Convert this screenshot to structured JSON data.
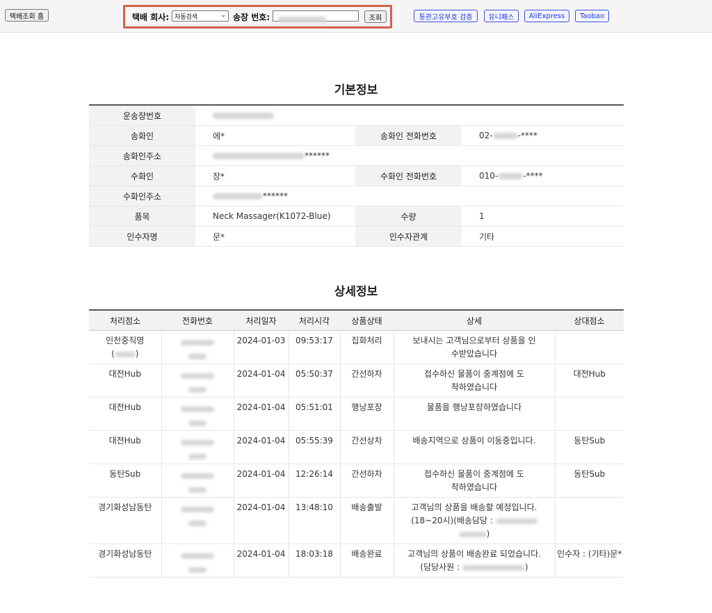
{
  "toolbar": {
    "home_button": "택배조회 홈",
    "carrier_label": "택배 회사:",
    "carrier_value": "자동검색",
    "tracking_label": "송장 번호:",
    "search_button": "조회",
    "links": [
      "통관고유부호 검증",
      "유니패스",
      "AliExpress",
      "Taobao"
    ]
  },
  "basic_info": {
    "title": "기본정보",
    "waybill_label": "운송장번호",
    "sender_label": "송화인",
    "sender_value": "에*",
    "sender_phone_label": "송화인 전화번호",
    "sender_phone_prefix": "02-",
    "sender_phone_suffix": "-****",
    "sender_address_label": "송화인주소",
    "sender_address_suffix": "******",
    "receiver_label": "수화인",
    "receiver_value": "장*",
    "receiver_phone_label": "수화인 전화번호",
    "receiver_phone_prefix": "010-",
    "receiver_phone_suffix": "-****",
    "receiver_address_label": "수화인주소",
    "receiver_address_suffix": "******",
    "item_label": "품목",
    "item_value": "Neck Massager(K1072-Blue)",
    "qty_label": "수량",
    "qty_value": "1",
    "recipient_label": "인수자명",
    "recipient_value": "문*",
    "relation_label": "인수자관계",
    "relation_value": "기타"
  },
  "detail_info": {
    "title": "상세정보",
    "headers": [
      "처리점소",
      "전화번호",
      "처리일자",
      "처리시각",
      "상품상태",
      "상세",
      "상대점소"
    ],
    "rows": [
      {
        "office": "인천중직영",
        "office_extra": "(",
        "office_extra_end": ")",
        "date": "2024-01-03",
        "time": "09:53:17",
        "status": "집화처리",
        "detail": "보내시는 고객님으로부터 상품을 인수받았습니다",
        "counterpart": ""
      },
      {
        "office": "대전Hub",
        "date": "2024-01-04",
        "time": "05:50:37",
        "status": "간선하차",
        "detail": "접수하신 물품이 중계점에 도착하였습니다",
        "counterpart": "대전Hub"
      },
      {
        "office": "대전Hub",
        "date": "2024-01-04",
        "time": "05:51:01",
        "status": "행낭포장",
        "detail": "물품을 행낭포장하였습니다",
        "counterpart": ""
      },
      {
        "office": "대전Hub",
        "date": "2024-01-04",
        "time": "05:55:39",
        "status": "간선상차",
        "detail": "배송지역으로 상품이 이동중입니다.",
        "counterpart": "동탄Sub"
      },
      {
        "office": "동탄Sub",
        "date": "2024-01-04",
        "time": "12:26:14",
        "status": "간선하차",
        "detail": "접수하신 물품이 중계점에 도착하였습니다",
        "counterpart": "동탄Sub"
      },
      {
        "office": "경기화성남동탄",
        "date": "2024-01-04",
        "time": "13:48:10",
        "status": "배송출발",
        "detail": "고객님의 상품을 배송할 예정입니다. (18~20시)(배송담당 :",
        "detail_end": ")",
        "counterpart": ""
      },
      {
        "office": "경기화성남동탄",
        "date": "2024-01-04",
        "time": "18:03:18",
        "status": "배송완료",
        "detail": "고객님의 상품이 배송완료 되었습니다. (담당사원 :",
        "detail_end": ")",
        "counterpart": "인수자 : (기타)문*"
      }
    ]
  }
}
